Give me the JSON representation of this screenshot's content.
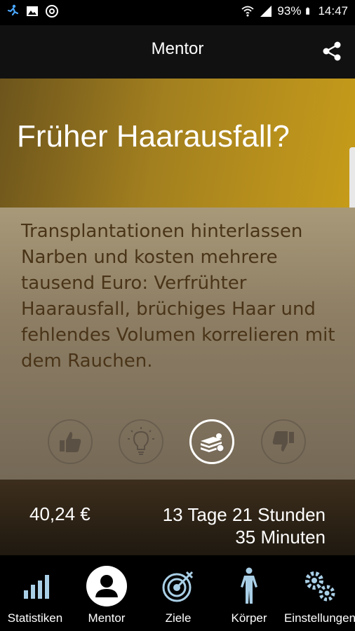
{
  "status_bar": {
    "battery": "93%",
    "time": "14:47"
  },
  "header": {
    "title": "Mentor"
  },
  "article": {
    "headline": "Früher Haarausfall?",
    "body": "Transplantationen hinterlassen Narben und kosten mehrere tausend Euro: Verfrühter Haarausfall, brüchiges Haar und fehlendes Volumen korrelieren mit dem Rauchen."
  },
  "actions": [
    "thumbs-up-icon",
    "lightbulb-icon",
    "money-icon",
    "thumbs-down-icon"
  ],
  "stats": {
    "money": "40,24 €",
    "time_line1": "13 Tage 21 Stunden",
    "time_line2": "35 Minuten"
  },
  "nav": {
    "items": [
      {
        "label": "Statistiken",
        "icon": "bar-chart-icon"
      },
      {
        "label": "Mentor",
        "icon": "person-icon"
      },
      {
        "label": "Ziele",
        "icon": "target-icon"
      },
      {
        "label": "Körper",
        "icon": "body-icon"
      },
      {
        "label": "Einstellungen",
        "icon": "gears-icon"
      }
    ]
  },
  "colors": {
    "accent_gold": "#c79c1a",
    "text_brown": "#4a3418",
    "nav_icon": "#a9cfe6"
  }
}
